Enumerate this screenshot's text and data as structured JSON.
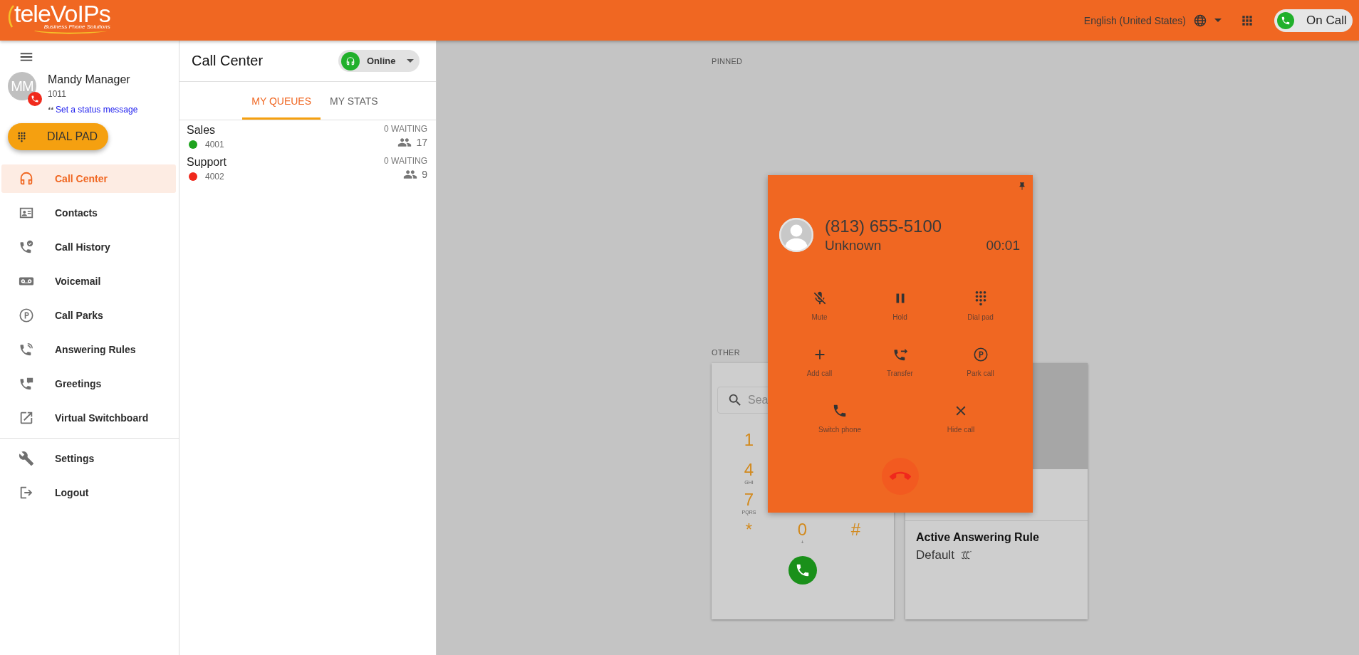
{
  "top_bar": {
    "logo": {
      "name": "teleVoIPs",
      "tagline": "Business Phone Solutions"
    },
    "language": "English (United States)",
    "call_status": "On Call"
  },
  "sidebar": {
    "user": {
      "initials": "MM",
      "name": "Mandy Manager",
      "extension": "1011",
      "status_link": "Set a status message"
    },
    "dial_pad_button": "DIAL PAD",
    "nav": [
      {
        "label": "Call Center",
        "selected": true
      },
      {
        "label": "Contacts",
        "selected": false
      },
      {
        "label": "Call History",
        "selected": false
      },
      {
        "label": "Voicemail",
        "selected": false
      },
      {
        "label": "Call Parks",
        "selected": false
      },
      {
        "label": "Answering Rules",
        "selected": false
      },
      {
        "label": "Greetings",
        "selected": false
      },
      {
        "label": "Virtual Switchboard",
        "selected": false
      }
    ],
    "bottom_nav": [
      {
        "label": "Settings",
        "selected": false
      },
      {
        "label": "Logout",
        "selected": false
      }
    ]
  },
  "call_center": {
    "title": "Call Center",
    "status": "Online",
    "tabs": [
      {
        "label": "MY QUEUES",
        "selected": true
      },
      {
        "label": "MY STATS",
        "selected": false
      }
    ],
    "queues": [
      {
        "name": "Sales",
        "number": "4001",
        "color": "#1ea31e",
        "waiting": "0 WAITING",
        "agents": "17"
      },
      {
        "name": "Support",
        "number": "4002",
        "color": "#f0281c",
        "waiting": "0 WAITING",
        "agents": "9"
      }
    ]
  },
  "main": {
    "pinned_label": "PINNED",
    "other_label": "OTHER",
    "dialer": {
      "search_placeholder": "Sea",
      "key_columns": [
        [
          {
            "digit": "1"
          },
          {
            "digit": "4",
            "letters": "GHI"
          },
          {
            "digit": "7",
            "letters": "PQRS"
          },
          {
            "digit": "*"
          }
        ],
        [
          {
            "digit": "0",
            "letters": "+"
          }
        ],
        [
          {
            "digit": "#"
          }
        ]
      ]
    },
    "answering_rule": {
      "title": "Active Answering Rule",
      "value": "Default"
    }
  },
  "call": {
    "number": "(813) 655-5100",
    "name": "Unknown",
    "duration": "00:01",
    "actions": [
      {
        "label": "Mute"
      },
      {
        "label": "Hold"
      },
      {
        "label": "Dial pad"
      },
      {
        "label": "Add call"
      },
      {
        "label": "Transfer"
      },
      {
        "label": "Park call"
      },
      {
        "label": "Switch phone"
      },
      {
        "label": "Hide call"
      }
    ]
  }
}
